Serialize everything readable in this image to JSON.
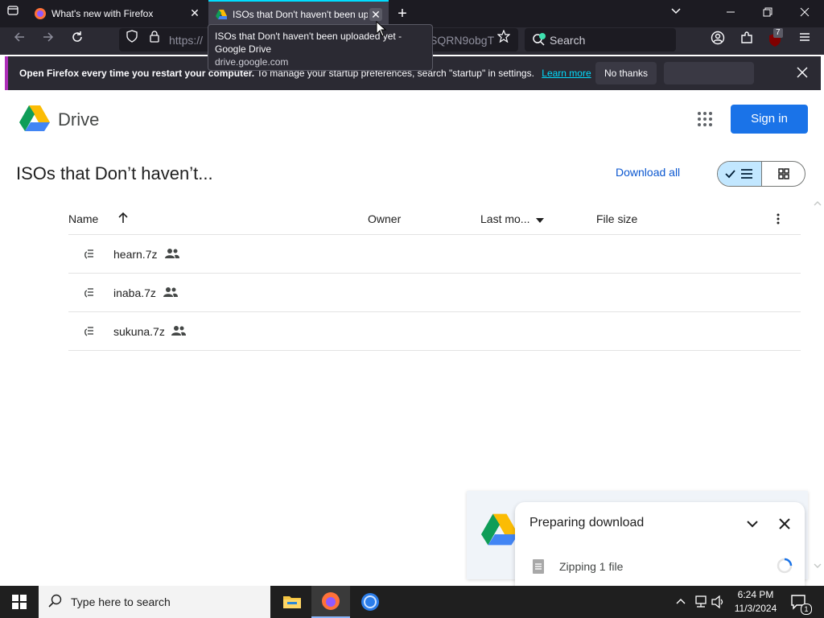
{
  "browser": {
    "tabs": [
      {
        "title": "What's new with Firefox",
        "active": false
      },
      {
        "title": "ISOs that Don't haven't been up",
        "active": true
      }
    ],
    "url_left": "https://",
    "url_right": "SQRN9obgT",
    "search_placeholder": "Search",
    "extension_badge": "7",
    "tooltip": {
      "title": "ISOs that Don't haven't been uploaded yet - Google Drive",
      "url": "drive.google.com"
    },
    "notification": {
      "bold_text": "Open Firefox every time you restart your computer.",
      "text": "To manage your startup preferences, search \"startup\" in settings.",
      "link": "Learn more",
      "no_thanks": "No thanks"
    }
  },
  "drive": {
    "app_name": "Drive",
    "sign_in": "Sign in",
    "folder_title": "ISOs that Don’t haven’t...",
    "download_all": "Download all",
    "columns": {
      "name": "Name",
      "owner": "Owner",
      "last_modified": "Last mo...",
      "file_size": "File size"
    },
    "files": [
      {
        "name": "hearn.7z"
      },
      {
        "name": "inaba.7z"
      },
      {
        "name": "sukuna.7z"
      }
    ],
    "download_panel": {
      "title": "Preparing download",
      "status": "Zipping 1 file"
    }
  },
  "taskbar": {
    "search_placeholder": "Type here to search",
    "time": "6:24 PM",
    "date": "11/3/2024",
    "notification_count": "1"
  },
  "colors": {
    "firefox_dark": "#1c1b22",
    "drive_blue": "#1a73e8",
    "accent_cyan": "#00ddff"
  }
}
